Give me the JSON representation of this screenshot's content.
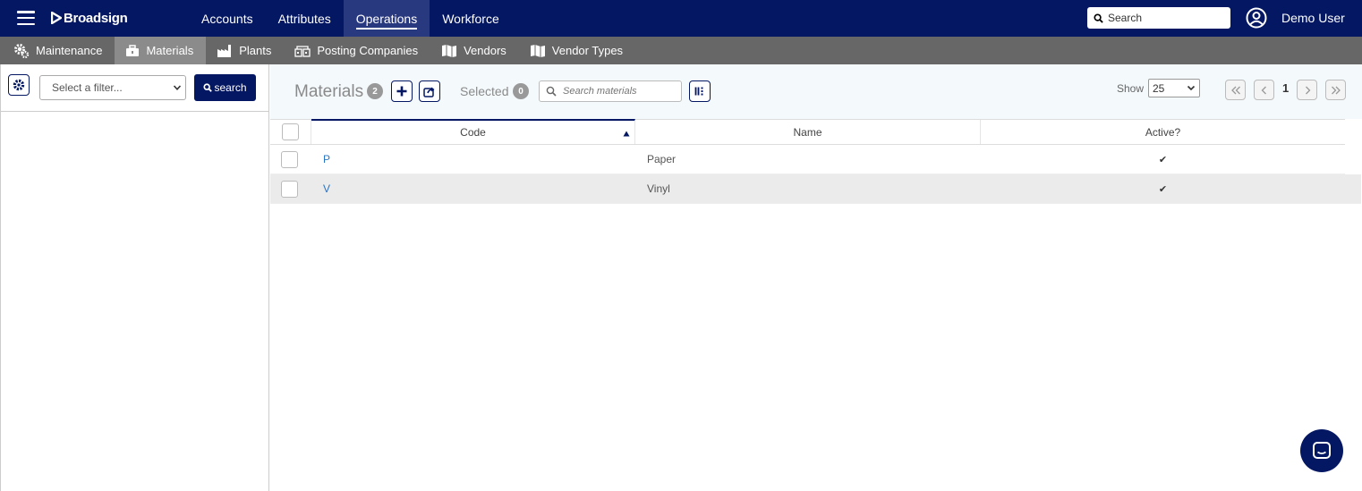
{
  "header": {
    "logo": "Broadsign",
    "nav": [
      {
        "label": "Accounts"
      },
      {
        "label": "Attributes"
      },
      {
        "label": "Operations"
      },
      {
        "label": "Workforce"
      }
    ],
    "search_placeholder": "Search",
    "user_name": "Demo User",
    "brand_color": "#041763"
  },
  "subnav": [
    {
      "label": "Maintenance",
      "icon": "gears-icon"
    },
    {
      "label": "Materials",
      "icon": "toolbox-icon"
    },
    {
      "label": "Plants",
      "icon": "factory-icon"
    },
    {
      "label": "Posting Companies",
      "icon": "buildings-icon"
    },
    {
      "label": "Vendors",
      "icon": "map-icon"
    },
    {
      "label": "Vendor Types",
      "icon": "map-icon"
    }
  ],
  "filter": {
    "select_placeholder": "Select a filter...",
    "search_label": "search"
  },
  "materials": {
    "title": "Materials",
    "count": "2",
    "selected_label": "Selected",
    "selected_count": "0",
    "search_placeholder": "Search materials",
    "show_label": "Show",
    "page_size": "25",
    "page": "1",
    "columns": [
      "Code",
      "Name",
      "Active?"
    ],
    "rows": [
      {
        "code": "P",
        "name": "Paper",
        "active": "✔"
      },
      {
        "code": "V",
        "name": "Vinyl",
        "active": "✔"
      }
    ]
  }
}
